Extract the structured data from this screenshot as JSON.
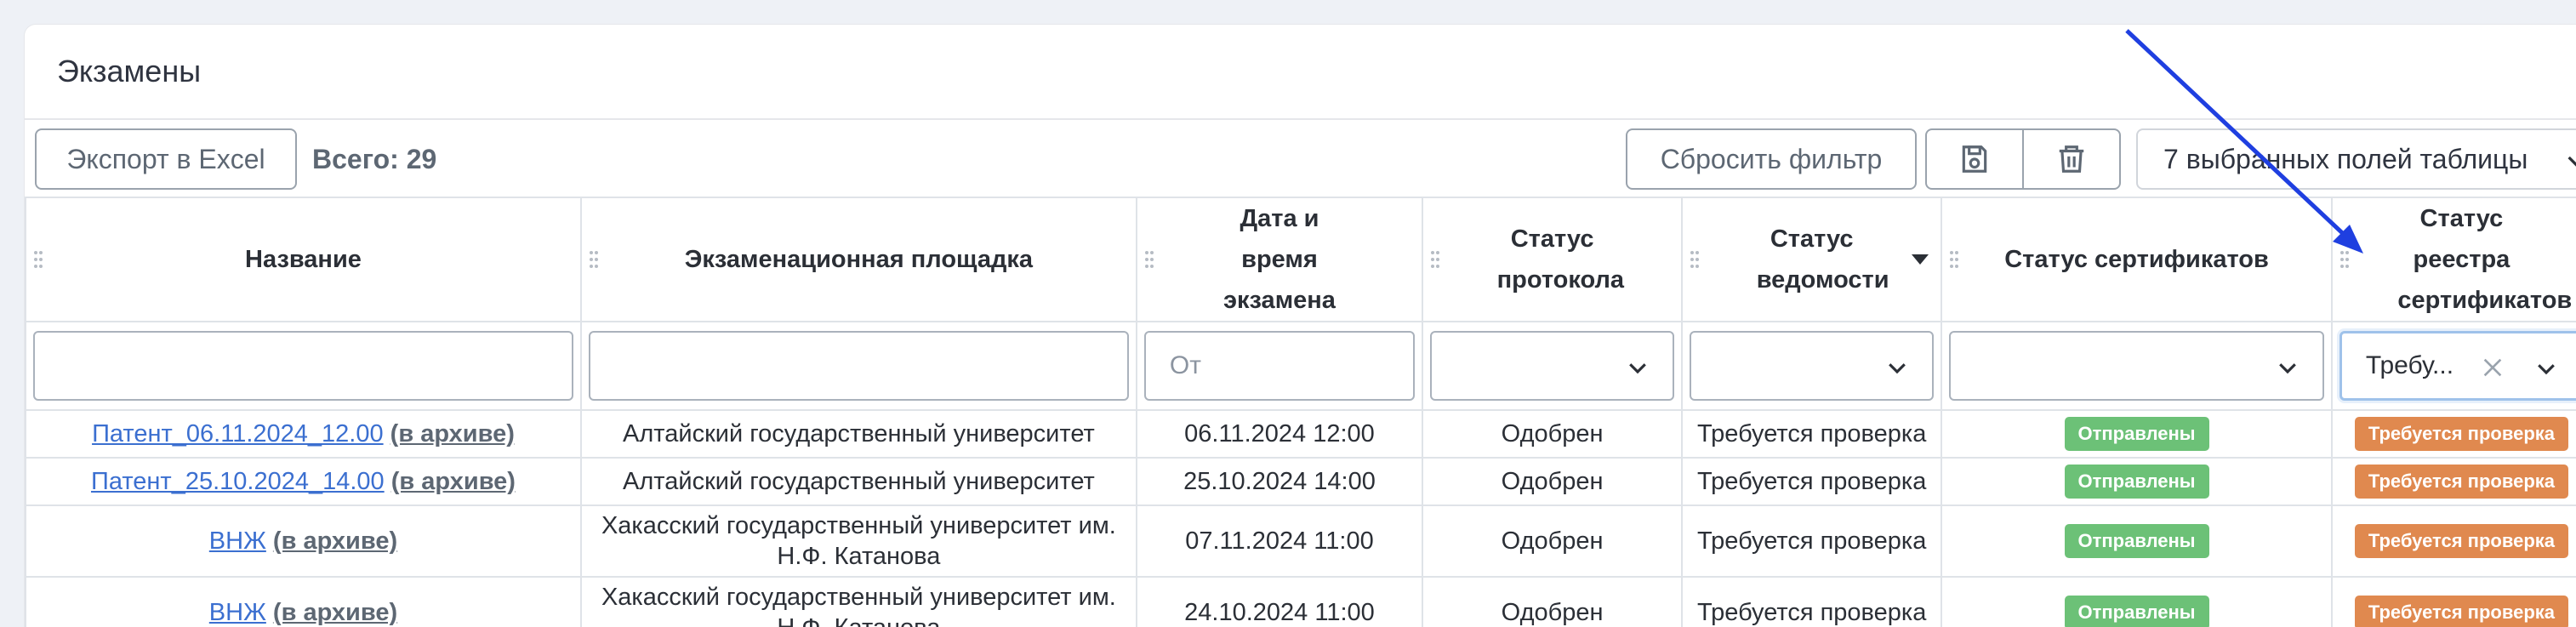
{
  "page": {
    "title": "Экзамены"
  },
  "toolbar": {
    "export_label": "Экспорт в Excel",
    "total_label": "Всего: 29",
    "reset_label": "Сбросить фильтр",
    "fields_label": "7 выбранных полей таблицы"
  },
  "columns": [
    "Название",
    "Экзаменационная площадка",
    "Дата и время экзамена",
    "Статус протокола",
    "Статус ведомости",
    "Статус сертификатов",
    "Статус реестра сертификатов"
  ],
  "filters": {
    "date_placeholder": "От",
    "registry_value": "Требу..."
  },
  "rows": [
    {
      "name": "Патент_06.11.2024_12.00",
      "archive": "(в архиве)",
      "site": "Алтайский государственный университет",
      "site2": "",
      "datetime": "06.11.2024 12:00",
      "protocol": "Одобрен",
      "sheet": "Требуется проверка",
      "certs": "Отправлены",
      "registry": "Требуется проверка"
    },
    {
      "name": "Патент_25.10.2024_14.00",
      "archive": "(в архиве)",
      "site": "Алтайский государственный университет",
      "site2": "",
      "datetime": "25.10.2024 14:00",
      "protocol": "Одобрен",
      "sheet": "Требуется проверка",
      "certs": "Отправлены",
      "registry": "Требуется проверка"
    },
    {
      "name": "ВНЖ",
      "archive": "(в архиве)",
      "site": "Хакасский государственный университет им.",
      "site2": "Н.Ф. Катанова",
      "datetime": "07.11.2024 11:00",
      "protocol": "Одобрен",
      "sheet": "Требуется проверка",
      "certs": "Отправлены",
      "registry": "Требуется проверка"
    },
    {
      "name": "ВНЖ",
      "archive": "(в архиве)",
      "site": "Хакасский государственный университет им.",
      "site2": "Н.Ф. Катанова",
      "datetime": "24.10.2024 11:00",
      "protocol": "Одобрен",
      "sheet": "Требуется проверка",
      "certs": "Отправлены",
      "registry": "Требуется проверка"
    }
  ],
  "colors": {
    "accent_link": "#3b6fd0",
    "badge_green": "#6cc177",
    "badge_orange": "#e0894f",
    "annotation_arrow": "#1f3fe0"
  },
  "icons": [
    "save-icon",
    "trash-icon",
    "chevron-down-icon",
    "drag-handle-icon",
    "clear-icon",
    "sort-down-icon"
  ]
}
